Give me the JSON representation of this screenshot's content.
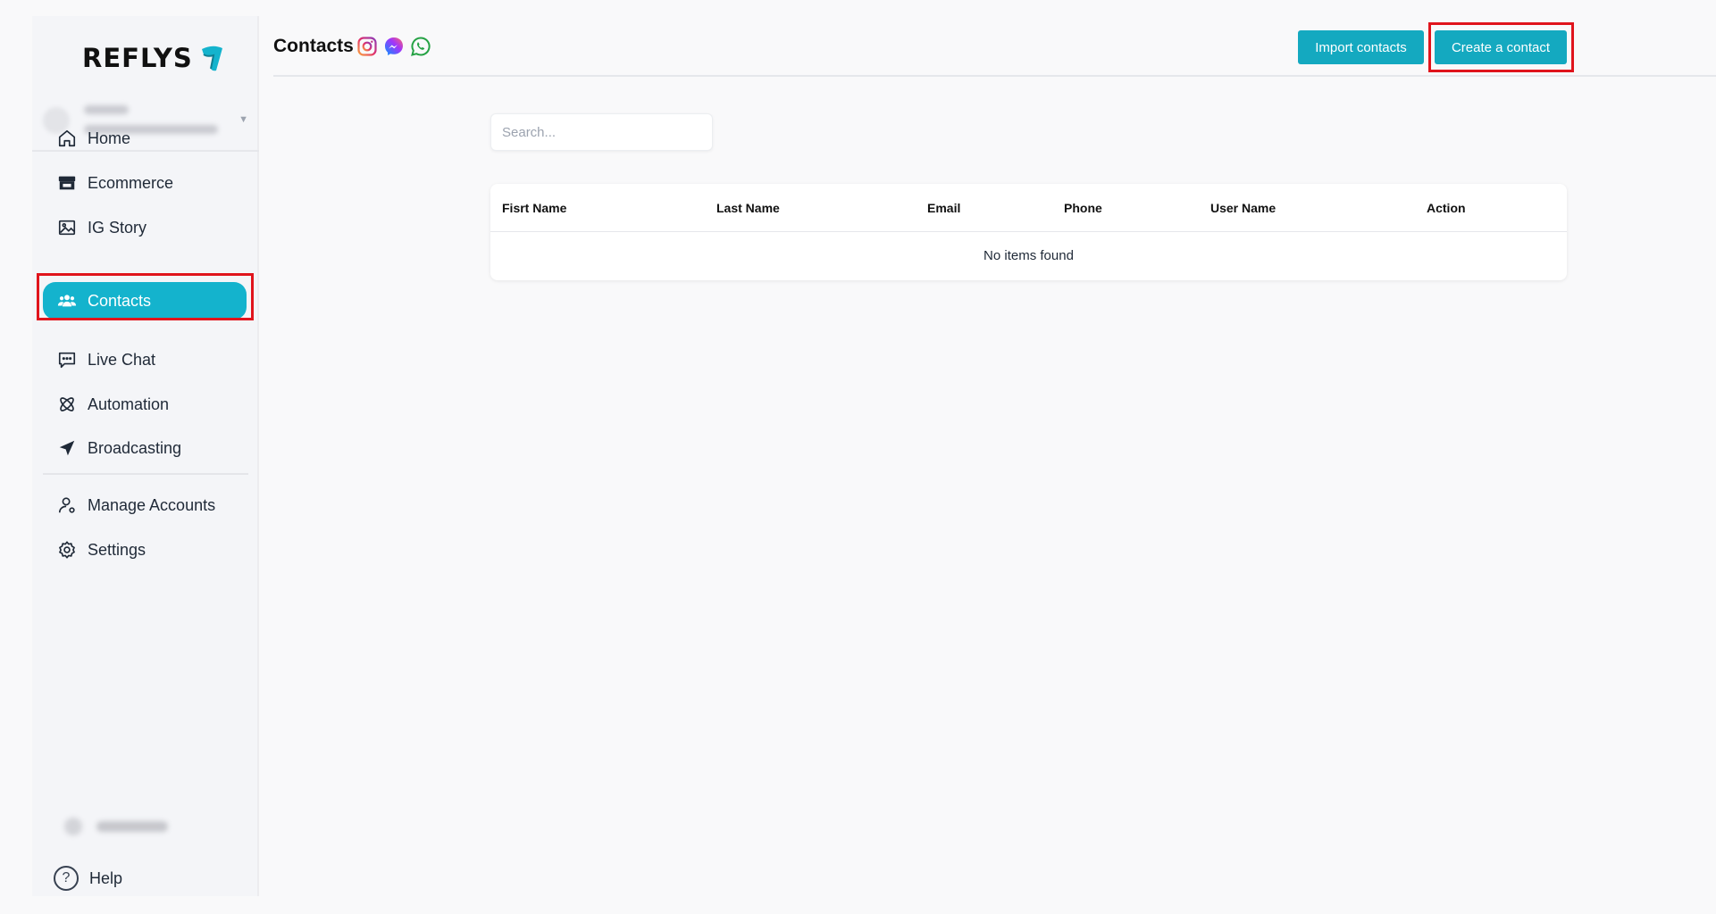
{
  "app": {
    "logo_text": "REFLYS"
  },
  "sidebar": {
    "items": [
      {
        "label": "Home",
        "icon": "home-icon"
      },
      {
        "label": "Ecommerce",
        "icon": "store-icon"
      },
      {
        "label": "IG Story",
        "icon": "image-icon"
      },
      {
        "label": "Contacts",
        "icon": "users-icon",
        "active": true
      },
      {
        "label": "Live Chat",
        "icon": "chat-icon"
      },
      {
        "label": "Automation",
        "icon": "automation-icon"
      },
      {
        "label": "Broadcasting",
        "icon": "send-icon"
      }
    ],
    "secondary": [
      {
        "label": "Manage Accounts",
        "icon": "user-icon"
      },
      {
        "label": "Settings",
        "icon": "gear-icon"
      }
    ],
    "help_label": "Help",
    "help_icon": "?"
  },
  "header": {
    "title": "Contacts",
    "channels": [
      "instagram-icon",
      "messenger-icon",
      "whatsapp-icon"
    ],
    "import_label": "Import contacts",
    "create_label": "Create a contact"
  },
  "search": {
    "placeholder": "Search..."
  },
  "table": {
    "columns": [
      "Fisrt Name",
      "Last Name",
      "Email",
      "Phone",
      "User Name",
      "Action"
    ],
    "empty_text": "No items found"
  },
  "colors": {
    "accent": "#14b3cd",
    "button": "#14a9c0",
    "highlight": "#e0141c"
  }
}
